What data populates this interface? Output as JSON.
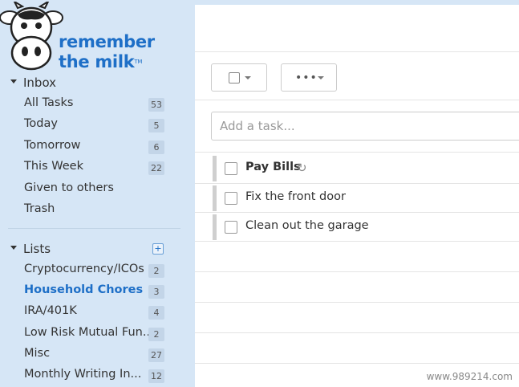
{
  "app": {
    "logo_line1": "remember",
    "logo_line2": "the milk",
    "logo_tm": "TM"
  },
  "inbox": {
    "header": "Inbox",
    "items": [
      {
        "label": "All Tasks",
        "count": "53"
      },
      {
        "label": "Today",
        "count": "5"
      },
      {
        "label": "Tomorrow",
        "count": "6"
      },
      {
        "label": "This Week",
        "count": "22"
      },
      {
        "label": "Given to others",
        "count": ""
      },
      {
        "label": "Trash",
        "count": ""
      }
    ]
  },
  "lists": {
    "header": "Lists",
    "add_icon": "+",
    "items": [
      {
        "label": "Cryptocurrency/ICOs",
        "count": "2"
      },
      {
        "label": "Household Chores",
        "count": "3"
      },
      {
        "label": "IRA/401K",
        "count": "4"
      },
      {
        "label": "Low Risk Mutual Fun...",
        "count": "2"
      },
      {
        "label": "Misc",
        "count": "27"
      },
      {
        "label": "Monthly Writing In...",
        "count": "12"
      }
    ]
  },
  "toolbar": {
    "select_icon": "checkbox-dropdown",
    "more_label": "•••"
  },
  "add_task": {
    "placeholder": "Add a task..."
  },
  "tasks": [
    {
      "name": "Pay Bills",
      "repeat": true
    },
    {
      "name": "Fix the front door",
      "repeat": false
    },
    {
      "name": "Clean out the garage",
      "repeat": false
    }
  ],
  "watermark": "www.989214.com",
  "colors": {
    "sidebar_bg": "#d6e6f6",
    "accent": "#1e6fc7"
  }
}
